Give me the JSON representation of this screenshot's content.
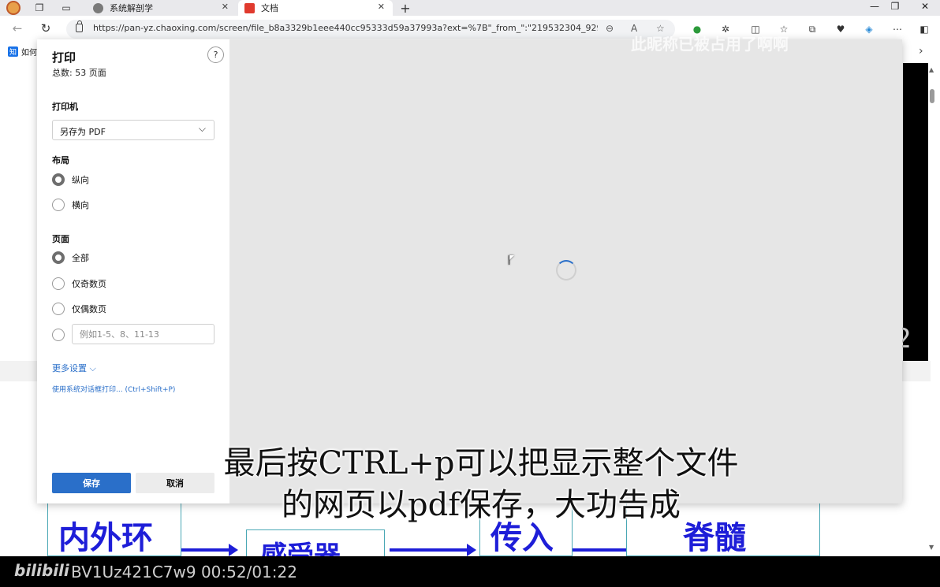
{
  "browser": {
    "tabs": [
      {
        "title": "系统解剖学",
        "active": false
      },
      {
        "title": "文档",
        "active": true
      }
    ],
    "new_tab": "+",
    "url": "https://pan-yz.chaoxing.com/screen/file_b8a3329b1eee440cc95333d59a37993a?ext=%7B\"_from_\":\"219532304_92971821_29...",
    "bookmark": "如何"
  },
  "print_dialog": {
    "title": "打印",
    "total_pages": "总数: 53 页面",
    "help": "?",
    "printer": {
      "label": "打印机",
      "selected": "另存为 PDF"
    },
    "layout": {
      "label": "布局",
      "options": [
        "纵向",
        "横向"
      ],
      "selected": 0
    },
    "pages": {
      "label": "页面",
      "options": [
        "全部",
        "仅奇数页",
        "仅偶数页"
      ],
      "selected": 0,
      "custom_placeholder": "例如1-5、8、11-13"
    },
    "more_settings": "更多设置 ⌵",
    "system_dialog": "使用系统对话框打印... (Ctrl+Shift+P)",
    "save": "保存",
    "cancel": "取消"
  },
  "background": {
    "diagram": [
      "内外环",
      "感受器",
      "传入",
      "脊髓"
    ],
    "black_digit": "2"
  },
  "video": {
    "subtitle_line1": "最后按CTRL+p可以把显示整个文件",
    "subtitle_line2": "的网页以pdf保存，大功告成",
    "watermark": "此昵称已被占用了啊啊",
    "logo": "bilibili",
    "bv_time": "BV1Uz421C7w9 00:52/01:22"
  },
  "colors": {
    "accent": "#2a6fc9",
    "diagram_text": "#1e1ed8",
    "diagram_border": "#4aa8b5"
  }
}
